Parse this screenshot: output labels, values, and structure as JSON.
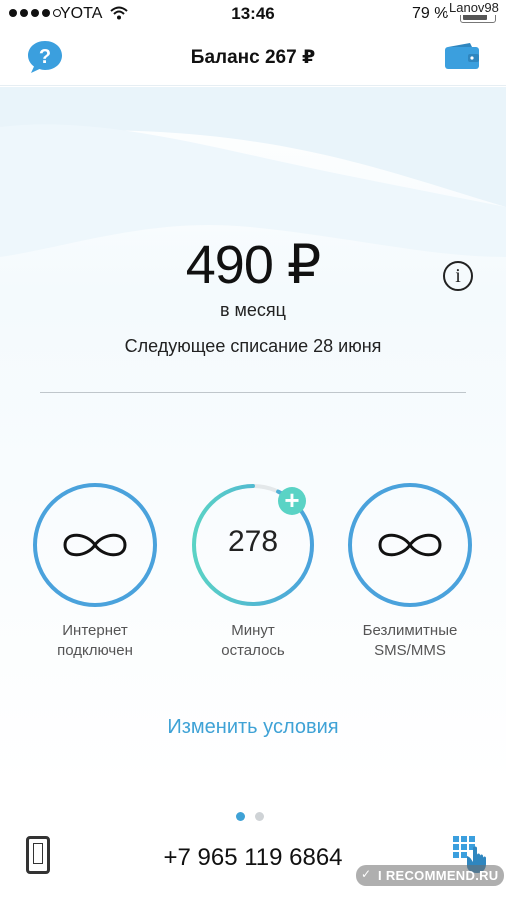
{
  "status_bar": {
    "carrier": "YOTA",
    "time": "13:46",
    "battery_percent": "79 %",
    "watermark": "Lanov98",
    "icons": [
      "signal-icon",
      "wifi-icon",
      "battery-icon"
    ]
  },
  "header": {
    "title": "Баланс 267 ₽",
    "left_icon": "help-icon",
    "right_icon": "wallet-icon"
  },
  "tariff": {
    "price": "490 ₽",
    "period": "в месяц",
    "next_charge": "Следующее списание 28 июня",
    "info_icon_label": "i"
  },
  "stats": [
    {
      "id": "internet",
      "value": "∞",
      "label_line1": "Интернет",
      "label_line2": "подключен"
    },
    {
      "id": "minutes",
      "value": "278",
      "label_line1": "Минут",
      "label_line2": "осталось"
    },
    {
      "id": "sms",
      "value": "∞",
      "label_line1": "Безлимитные",
      "label_line2": "SMS/MMS"
    }
  ],
  "minutes_ring_fraction": 0.93,
  "actions": {
    "change_conditions": "Изменить условия",
    "plus_label": "+"
  },
  "pager": {
    "pages": 2,
    "active": 0
  },
  "footer": {
    "phone_number": "+7 965 119 6864",
    "left_icon": "phone-icon",
    "right_icon": "keypad-icon"
  },
  "watermark_logo": "I RECOMMEND.RU",
  "colors": {
    "accent_blue": "#4aa2dc",
    "accent_teal": "#5ad3c5",
    "link": "#3fa2d6"
  }
}
